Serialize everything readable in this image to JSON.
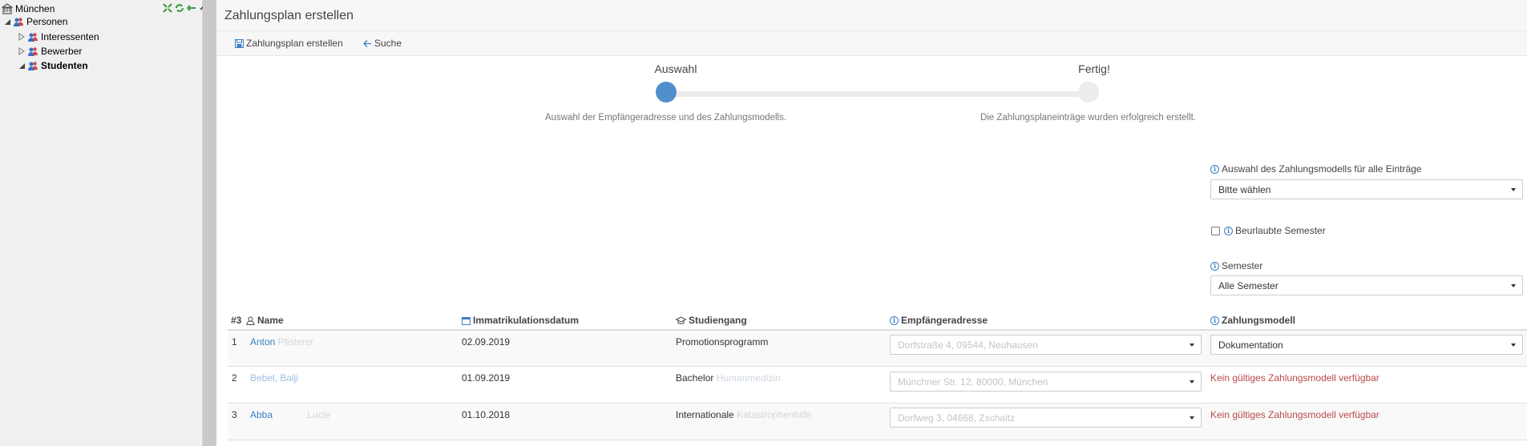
{
  "tree": {
    "root": "München",
    "personen": "Personen",
    "interessenten": "Interessenten",
    "bewerber": "Bewerber",
    "studenten": "Studenten"
  },
  "page": {
    "title": "Zahlungsplan erstellen"
  },
  "toolbar": {
    "create_label": "Zahlungsplan erstellen",
    "search_label": "Suche"
  },
  "wizard": {
    "step1_label": "Auswahl",
    "step1_desc": "Auswahl der Empfängeradresse und des Zahlungsmodells.",
    "step2_label": "Fertig!",
    "step2_desc": "Die Zahlungsplaneinträge wurden erfolgreich erstellt.",
    "active_color": "#4f8fcb"
  },
  "form": {
    "model_all_label": "Auswahl des Zahlungsmodells für alle Einträge",
    "model_all_value": "Bitte wählen",
    "leave_semester_label": "Beurlaubte Semester",
    "semester_label": "Semester",
    "semester_value": "Alle Semester"
  },
  "table": {
    "headers": {
      "num": "#3",
      "name": "Name",
      "date": "Immatrikulationsdatum",
      "program": "Studiengang",
      "address": "Empfängeradresse",
      "model": "Zahlungsmodell"
    },
    "rows": [
      {
        "num": "1",
        "name": "Anton",
        "name_hidden": "Pfisterer",
        "date": "02.09.2019",
        "program": "Promotionsprogramm",
        "program_hidden": "",
        "address": "Dorfstraße 4, 09544, Neuhausen",
        "model": "Dokumentation",
        "model_error": ""
      },
      {
        "num": "2",
        "name": "Bebel, Balji",
        "name_hidden": "",
        "date": "01.09.2019",
        "program": "Bachelor",
        "program_hidden": "Humanmedizin",
        "address": "Münchner Str. 12, 80000, München",
        "model": "",
        "model_error": "Kein gültiges Zahlungsmodell verfügbar"
      },
      {
        "num": "3",
        "name": "Abba",
        "name_hidden": "Lucie",
        "date": "01.10.2018",
        "program": "Internationale",
        "program_hidden": "Katastrophenhilfe",
        "address": "Dorfweg 3, 04668, Zschaitz",
        "model": "",
        "model_error": "Kein gültiges Zahlungsmodell verfügbar"
      }
    ]
  }
}
